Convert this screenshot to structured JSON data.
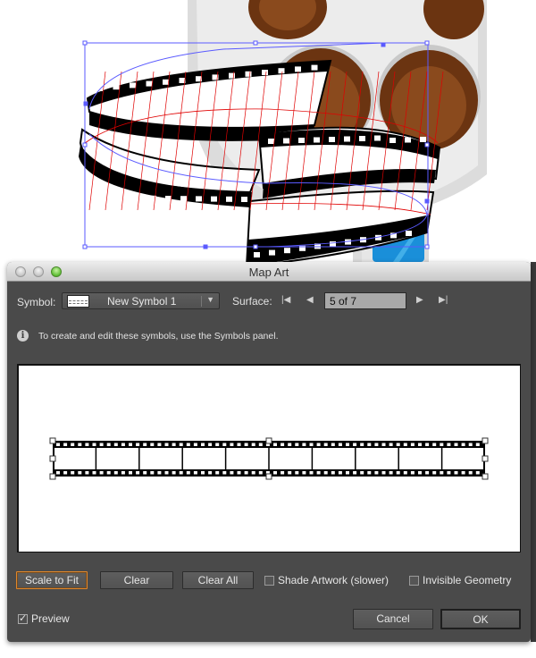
{
  "artboard": {
    "description": "Illustrator canvas with a 3D-mapped film strip wrapped around a cylinder in front of a film-reel icon",
    "colors": {
      "selection": "#5a5aff",
      "mesh": "#e00000",
      "reel_silver": "#d9d9d9",
      "reel_brown": "#7a3e14",
      "blue_tile": "#1a8fd9"
    }
  },
  "dialog": {
    "title": "Map Art",
    "symbol": {
      "label": "Symbol:",
      "selected": "New Symbol 1",
      "dropdown_icon": "triangle-down"
    },
    "surface": {
      "label": "Surface:",
      "value": "5 of 7",
      "first_icon": "first-page",
      "prev_icon": "prev-page",
      "next_icon": "next-page",
      "last_icon": "last-page",
      "glyphs": {
        "first": "|◀",
        "prev": "◀",
        "next": "▶",
        "last": "▶|"
      }
    },
    "info": {
      "icon": "info-icon",
      "text": "To create and edit these symbols, use the Symbols panel."
    },
    "buttons": {
      "scale_to_fit": "Scale to Fit",
      "clear": "Clear",
      "clear_all": "Clear All",
      "cancel": "Cancel",
      "ok": "OK"
    },
    "checkboxes": {
      "shade_artwork": {
        "label": "Shade Artwork (slower)",
        "checked": false
      },
      "invisible_geometry": {
        "label": "Invisible Geometry",
        "checked": false
      },
      "preview": {
        "label": "Preview",
        "checked": true
      }
    },
    "preview_area": {
      "film_frames": 10
    },
    "accent_color": "#e0862a"
  }
}
